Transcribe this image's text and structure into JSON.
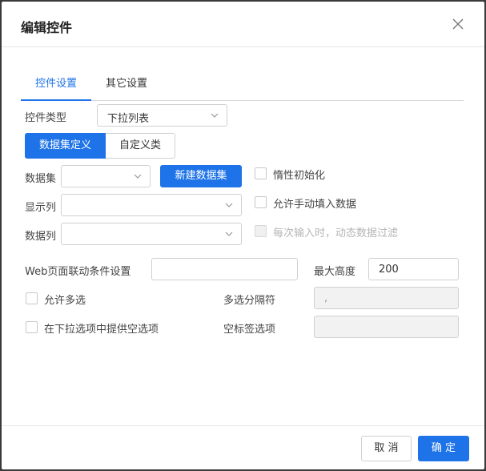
{
  "dialog": {
    "title": "编辑控件"
  },
  "tabs": [
    {
      "label": "控件设置",
      "active": true
    },
    {
      "label": "其它设置",
      "active": false
    }
  ],
  "form": {
    "control_type_label": "控件类型",
    "control_type_value": "下拉列表",
    "dataset_def_label": "数据集定义",
    "custom_class_label": "自定义类",
    "dataset_label": "数据集",
    "dataset_value": "",
    "new_dataset_label": "新建数据集",
    "display_col_label": "显示列",
    "display_col_value": "",
    "data_col_label": "数据列",
    "data_col_value": "",
    "lazy_init_label": "惰性初始化",
    "allow_manual_label": "允许手动填入数据",
    "dynamic_filter_label": "每次输入时，动态数据过滤",
    "web_link_label": "Web页面联动条件设置",
    "web_link_value": "",
    "max_height_label": "最大高度",
    "max_height_value": "200",
    "allow_multi_label": "允许多选",
    "multi_sep_label": "多选分隔符",
    "multi_sep_value": ",",
    "empty_option_label": "在下拉选项中提供空选项",
    "empty_tag_label": "空标签选项",
    "empty_tag_value": ""
  },
  "footer": {
    "cancel_label": "取 消",
    "ok_label": "确 定"
  },
  "colors": {
    "accent": "#1e73e8",
    "backdrop": "#3a3a3a"
  }
}
